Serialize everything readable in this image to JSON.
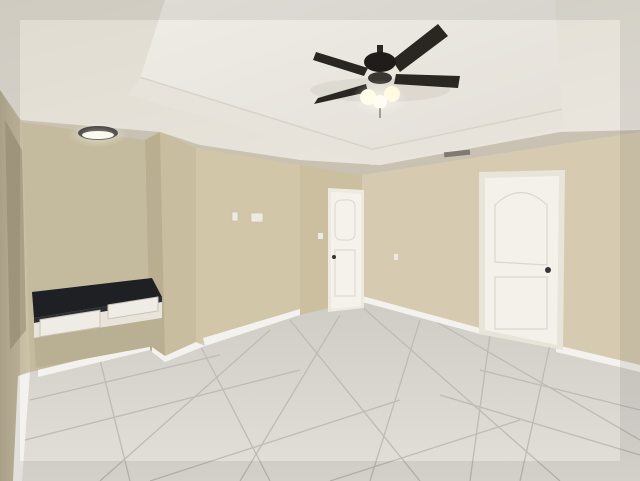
{
  "photo": {
    "alt": "",
    "colors": {
      "wall": "#d6cbb0",
      "wall_shadow": "#bfb394",
      "ceiling": "#e9e5dc",
      "tray_ceiling": "#efece6",
      "floor": "#d9d6d0",
      "grout": "#b9b5ae",
      "door": "#f2efe9",
      "baseboard": "#f4f2ee",
      "countertop": "#1e2024",
      "fan_blade": "#2a2723",
      "light": "#fffbe8"
    },
    "icons": [
      "ceiling-fan-icon",
      "door-icon",
      "light-fixture-icon"
    ]
  }
}
